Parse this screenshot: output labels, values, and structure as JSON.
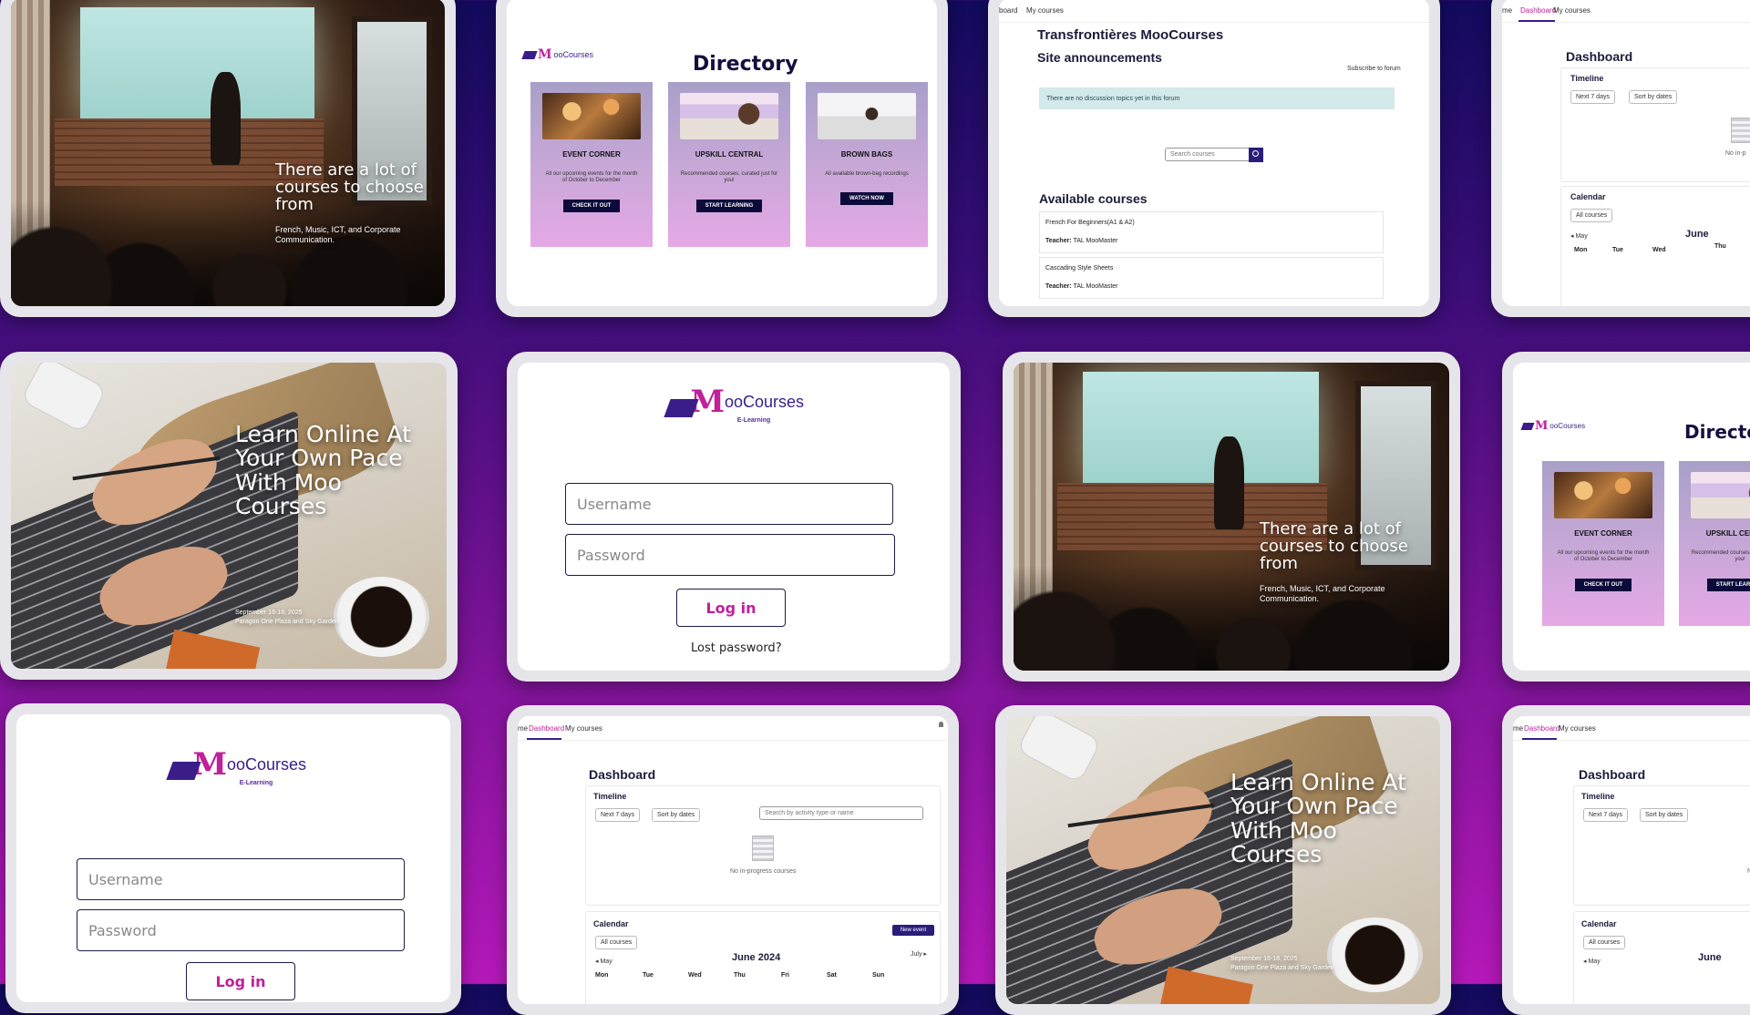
{
  "slides": {
    "stage": {
      "headline": "There are a lot of courses to choose from",
      "subtext": "French, Music, ICT, and Corporate Communication."
    },
    "desk": {
      "headline": "Learn Online At Your Own Pace With Moo Courses",
      "date": "September 16-18, 2025",
      "venue": "Paragon One Plaza and Sky Garden"
    }
  },
  "brand": {
    "logo_m": "M",
    "logo_rest": "ooCourses",
    "logo_sub": "E-Learning",
    "mini_sub": "E-Learning"
  },
  "directory": {
    "title": "Directory",
    "cards": [
      {
        "title": "EVENT CORNER",
        "desc": "All our upcoming events for the month of October to December",
        "button": "CHECK IT OUT"
      },
      {
        "title": "UPSKILL CENTRAL",
        "desc": "Recommended courses, curated just for you!",
        "button": "START LEARNING"
      },
      {
        "title": "BROWN BAGS",
        "desc": "All available brown-bag recordings",
        "button": "WATCH NOW"
      }
    ]
  },
  "announcements": {
    "nav": [
      "board",
      "My courses"
    ],
    "site_name": "Transfrontières MooCourses",
    "section": "Site announcements",
    "subscribe": "Subscribe to forum",
    "alert": "There are no discussion topics yet in this forum",
    "search_placeholder": "Search courses",
    "available": "Available courses",
    "courses": [
      {
        "name": "French For Beginners(A1 & A2)",
        "teacher_label": "Teacher:",
        "teacher": "TAL MooMaster"
      },
      {
        "name": "Cascading Style Sheets",
        "teacher_label": "Teacher:",
        "teacher": "TAL MooMaster"
      }
    ]
  },
  "dashboard": {
    "nav_home": "me",
    "nav_dashboard": "Dashboard",
    "nav_courses": "My courses",
    "title": "Dashboard",
    "timeline": "Timeline",
    "filter_days": "Next 7 days",
    "filter_sort": "Sort by dates",
    "search_placeholder": "Search by activity type or name",
    "empty": "No in-progress courses",
    "empty_short": "No in-p",
    "calendar": "Calendar",
    "calendar_filter": "All courses",
    "new_event": "New event",
    "month": "June 2024",
    "month_short": "June",
    "prev": "May",
    "next": "July",
    "weekdays": [
      "Mon",
      "Tue",
      "Wed",
      "Thu",
      "Fri",
      "Sat",
      "Sun"
    ]
  },
  "login": {
    "username_placeholder": "Username",
    "password_placeholder": "Password",
    "login_button": "Log in",
    "lost_password": "Lost password?"
  },
  "colors": {
    "accent": "#c0209a",
    "brand": "#3b1d8a",
    "dark": "#0c0a3a"
  }
}
